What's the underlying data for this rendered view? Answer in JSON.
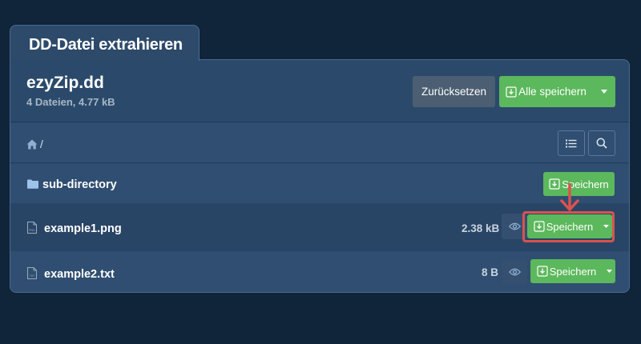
{
  "tab": {
    "title": "DD-Datei extrahieren"
  },
  "archive": {
    "name": "ezyZip.dd",
    "info": "4 Dateien, 4.77 kB"
  },
  "actions": {
    "reset_label": "Zurücksetzen",
    "save_all_label": "Alle speichern"
  },
  "breadcrumb": {
    "path": "/"
  },
  "rows": [
    {
      "type": "folder",
      "name": "sub-directory",
      "size": "",
      "save_label": "Speichern"
    },
    {
      "type": "file",
      "name": "example1.png",
      "size": "2.38 kB",
      "save_label": "Speichern",
      "icon_ext": "PNG"
    },
    {
      "type": "file",
      "name": "example2.txt",
      "size": "8 B",
      "save_label": "Speichern",
      "icon_ext": "TXT"
    }
  ],
  "colors": {
    "background": "#10243a",
    "panel": "#2b4a6b",
    "accent_green": "#5cb85c",
    "highlight_red": "#d9534f"
  },
  "icons": {
    "home": "home-icon",
    "list": "list-icon",
    "search": "search-icon",
    "folder": "folder-icon",
    "file": "file-icon",
    "eye": "eye-icon",
    "download": "download-icon"
  }
}
